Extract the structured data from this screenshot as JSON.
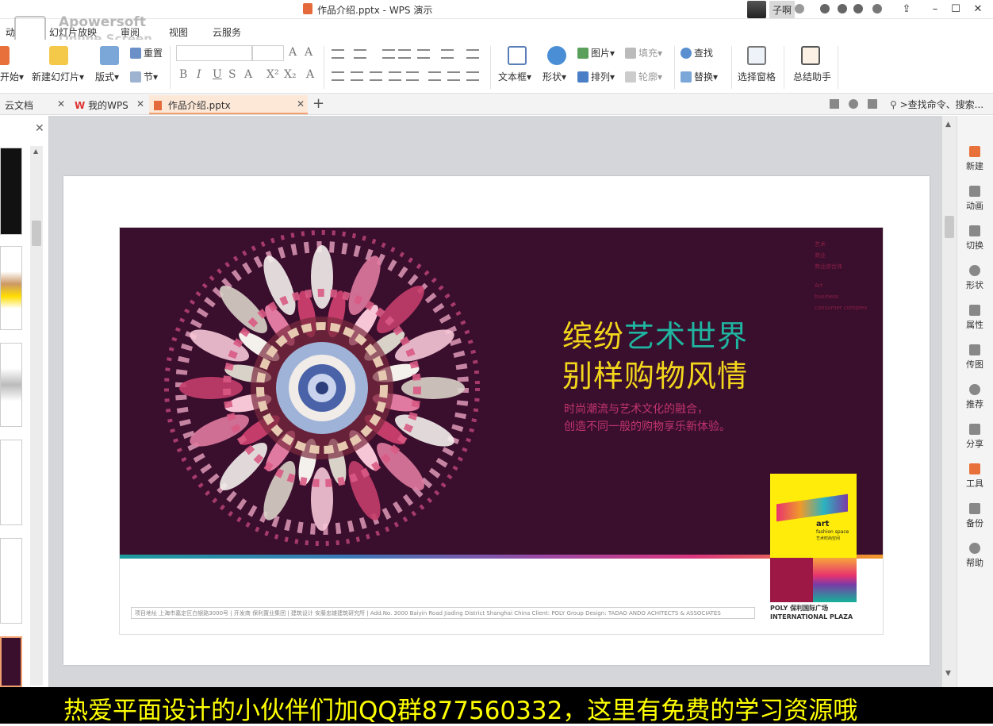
{
  "window": {
    "title": "作品介绍.pptx - WPS 演示",
    "user": "子啊",
    "user_menu": "▾"
  },
  "watermark": {
    "line1": "Apowersoft",
    "line2": "Online Screen Recorder"
  },
  "menu_tabs": [
    "动",
    "幻灯片放映",
    "审阅",
    "视图",
    "云服务"
  ],
  "ribbon": {
    "start_label": "开始",
    "new_slide": "新建幻灯片",
    "layout": "版式",
    "reset": "重置",
    "section": "节",
    "text_box": "文本框",
    "shape": "形状",
    "picture": "图片",
    "arrange": "排列",
    "fill": "填充",
    "outline": "轮廓",
    "find": "查找",
    "replace": "替换",
    "select_pane": "选择窗格",
    "summary": "总结助手"
  },
  "doc_tabs": [
    {
      "label": "云文档"
    },
    {
      "label": "我的WPS"
    },
    {
      "label": "作品介绍.pptx"
    }
  ],
  "search_placeholder": ">查找命令、搜索...",
  "right_panel": [
    "新建",
    "动画",
    "切换",
    "形状",
    "属性",
    "传图",
    "推荐",
    "分享",
    "工具",
    "备份",
    "帮助"
  ],
  "poster": {
    "headline_1a": "缤纷",
    "headline_1b": "艺术世界",
    "headline_2": "别样购物风情",
    "sub_1": "时尚潮流与艺术文化的融合，",
    "sub_2": "创造不同一般的购物享乐新体验。",
    "tiny_cn": [
      "艺术",
      "商业",
      "商业综合体"
    ],
    "tiny_en": [
      "Art",
      "business",
      "consumer complex"
    ],
    "logo_text_1": "art",
    "logo_text_2": "fashion space",
    "logo_text_3": "艺术时尚空间",
    "brand_1": "POLY 保利国际广场",
    "brand_2": "INTERNATIONAL PLAZA",
    "footer": "项目地址  上海市嘉定区白银路3000号 | 开发商  保利置业集团 | 建筑设计  安藤忠雄建筑研究所 | Add.No. 3000 Baiyin Road Jiading District Shanghai China Client: POLY Group   Design: TADAO ANDO ACHITECTS & ASSOCIATES",
    "colors": {
      "background": "#3a0e2d",
      "headline_yellow": "#f2d61c",
      "headline_teal": "#1fb5a0",
      "subtext": "#c0356e"
    }
  },
  "caption": "热爱平面设计的小伙伴们加QQ群877560332，这里有免费的学习资源哦"
}
